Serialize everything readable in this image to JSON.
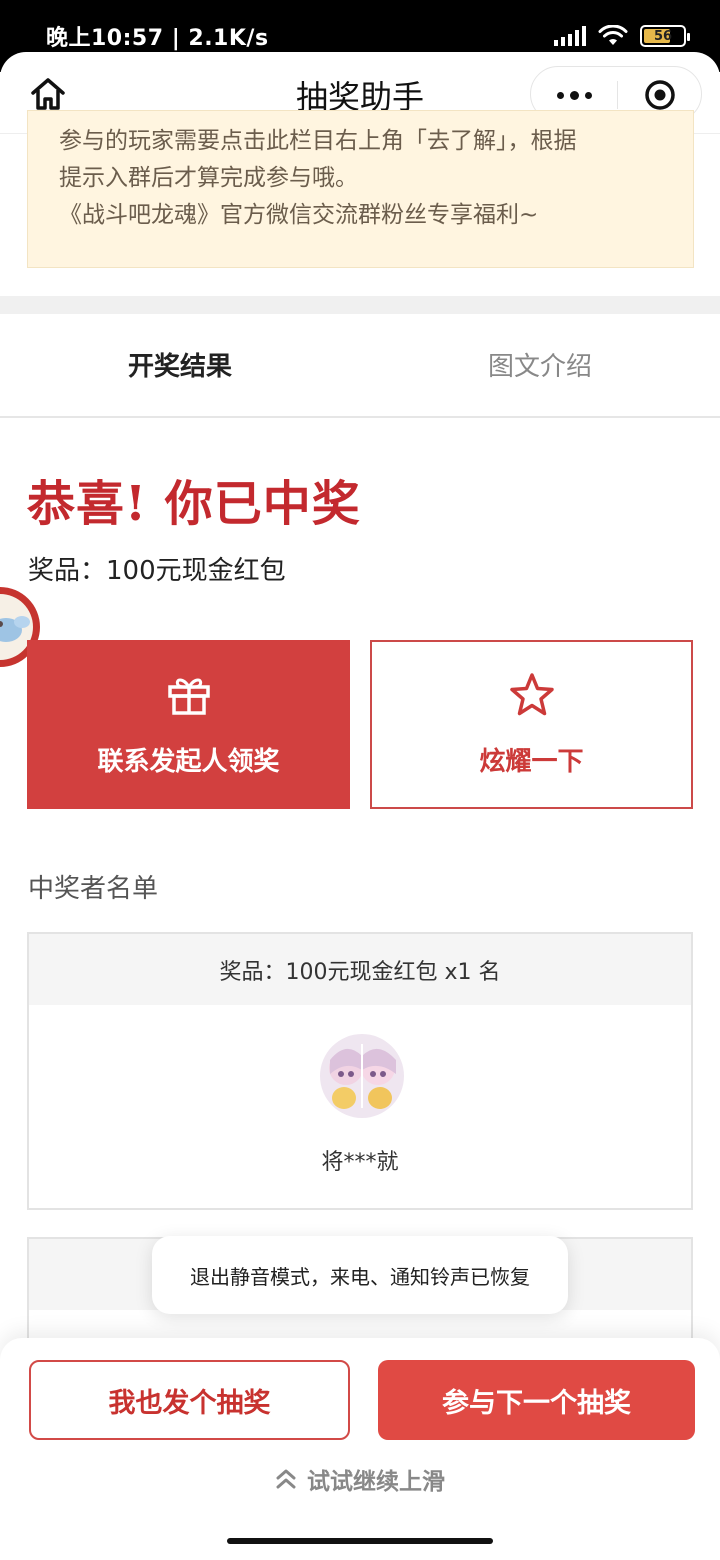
{
  "status_bar": {
    "time_speed": "晚上10:57 | 2.1K/s",
    "battery": "56"
  },
  "nav": {
    "title": "抽奖助手"
  },
  "notice": {
    "line1_clipped": "参与的玩家需要点击此栏目右上角「去了解」，根据",
    "line2": "提示入群后才算完成参与哦。",
    "line3": "《战斗吧龙魂》官方微信交流群粉丝专享福利~"
  },
  "tabs": [
    {
      "label": "开奖结果",
      "active": true
    },
    {
      "label": "图文介绍",
      "active": false
    }
  ],
  "result": {
    "headline": "恭喜! 你已中奖",
    "prize": "奖品：100元现金红包",
    "contact_button": "联系发起人领奖",
    "show_button": "炫耀一下"
  },
  "winners": {
    "title": "中奖者名单",
    "card_header": "奖品：100元现金红包 x1 名",
    "winner_name": "将***就"
  },
  "toast": {
    "text": "退出静音模式，来电、通知铃声已恢复"
  },
  "bottom": {
    "left_button": "我也发个抽奖",
    "right_button": "参与下一个抽奖",
    "swipe_hint": "试试继续上滑"
  },
  "colors": {
    "accent_red": "#d2403f",
    "headline_red": "#c3292e",
    "notice_bg": "#fff5e0"
  }
}
